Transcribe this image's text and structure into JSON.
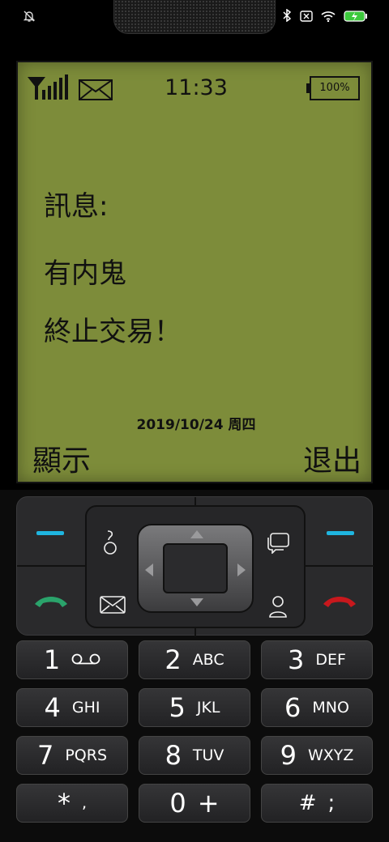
{
  "lcd": {
    "time": "11:33",
    "battery": "100%",
    "title": "訊息:",
    "message_line1": "有内鬼",
    "message_line2": "終止交易！",
    "date": "2019/10/24 周四",
    "soft_left": "顯示",
    "soft_right": "退出"
  },
  "keys": [
    {
      "num": "1",
      "sub": ""
    },
    {
      "num": "2",
      "sub": "ABC"
    },
    {
      "num": "3",
      "sub": "DEF"
    },
    {
      "num": "4",
      "sub": "GHI"
    },
    {
      "num": "5",
      "sub": "JKL"
    },
    {
      "num": "6",
      "sub": "MNO"
    },
    {
      "num": "7",
      "sub": "PQRS"
    },
    {
      "num": "8",
      "sub": "TUV"
    },
    {
      "num": "9",
      "sub": "WXYZ"
    },
    {
      "num": "*",
      "sub": ","
    },
    {
      "num": "0",
      "sub": "+"
    },
    {
      "num": "#",
      "sub": ";"
    }
  ],
  "colors": {
    "lcd_bg": "#7d8c3a",
    "softkey_accent": "#1fb5e0",
    "call_green": "#2aa36b",
    "end_red": "#c8181d"
  }
}
